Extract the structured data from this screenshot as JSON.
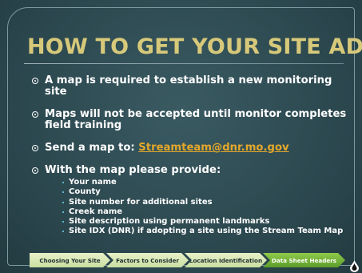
{
  "slide": {
    "title": "HOW TO GET YOUR SITE ADDED",
    "bullets": [
      "A map is required to establish a new monitoring site",
      "Maps will not be accepted until monitor completes field training",
      "Send a map to: ",
      "With the map please provide:"
    ],
    "email": "Streamteam@dnr.mo.gov",
    "provide_items": [
      "Your name",
      "County",
      "Site number for additional sites",
      "Creek name",
      "Site description using permanent landmarks",
      "Site IDX (DNR) if adopting a site using the Stream Team Map"
    ]
  },
  "nav": {
    "items": [
      "Choosing Your Site",
      "Factors to Consider",
      "Location Identification",
      "Data Sheet Headers"
    ],
    "active_index": 3
  },
  "colors": {
    "title": "#d7c97a",
    "email": "#e4a82a",
    "sub_bullet": "#5fb6cf",
    "nav_light": "#e7f1c8",
    "nav_active": "#7ab43c"
  },
  "icons": {
    "bullet": "circle-dot-icon",
    "corner_logo": "water-drop-icon"
  }
}
